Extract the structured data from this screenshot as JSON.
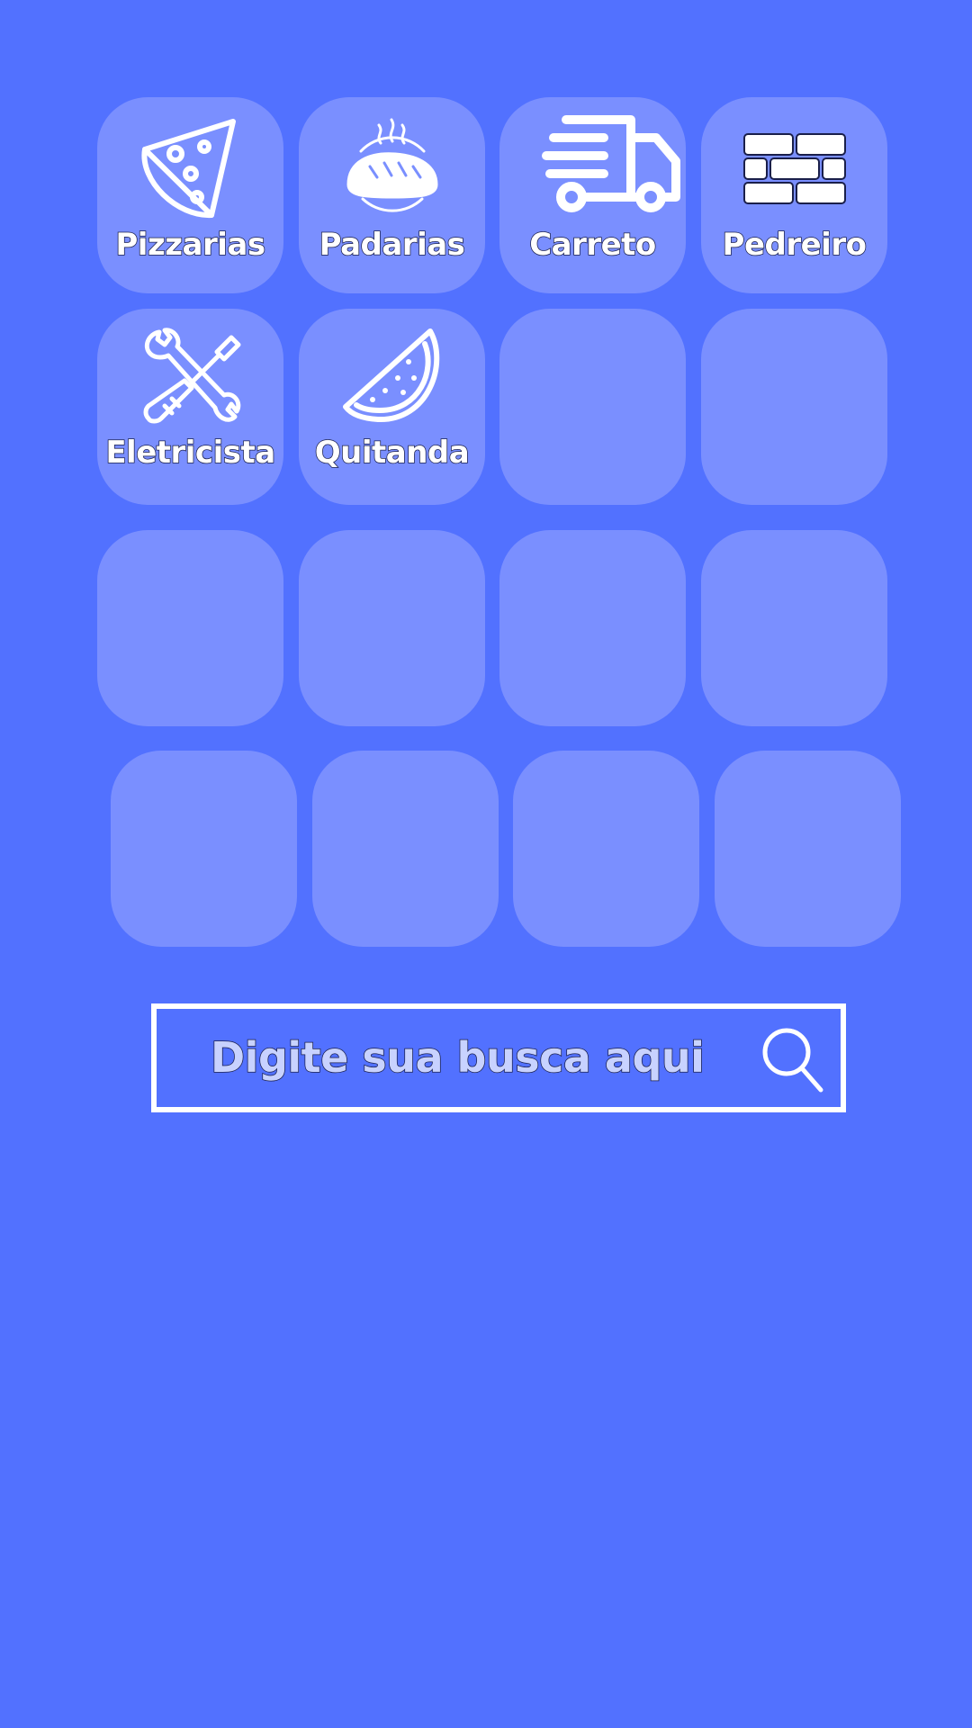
{
  "categories": [
    {
      "label": "Pizzarias",
      "icon": "pizza-slice-icon"
    },
    {
      "label": "Padarias",
      "icon": "bread-icon"
    },
    {
      "label": "Carreto",
      "icon": "delivery-truck-icon"
    },
    {
      "label": "Pedreiro",
      "icon": "brick-wall-icon"
    },
    {
      "label": "Eletricista",
      "icon": "wrench-screwdriver-icon"
    },
    {
      "label": "Quitanda",
      "icon": "watermelon-slice-icon"
    }
  ],
  "search": {
    "placeholder": "Digite sua busca aqui",
    "icon": "search-icon"
  },
  "colors": {
    "background": "#5271ff",
    "tile": "#7a8fff",
    "text": "#ffffff",
    "search_text": "#c8d2ff"
  }
}
